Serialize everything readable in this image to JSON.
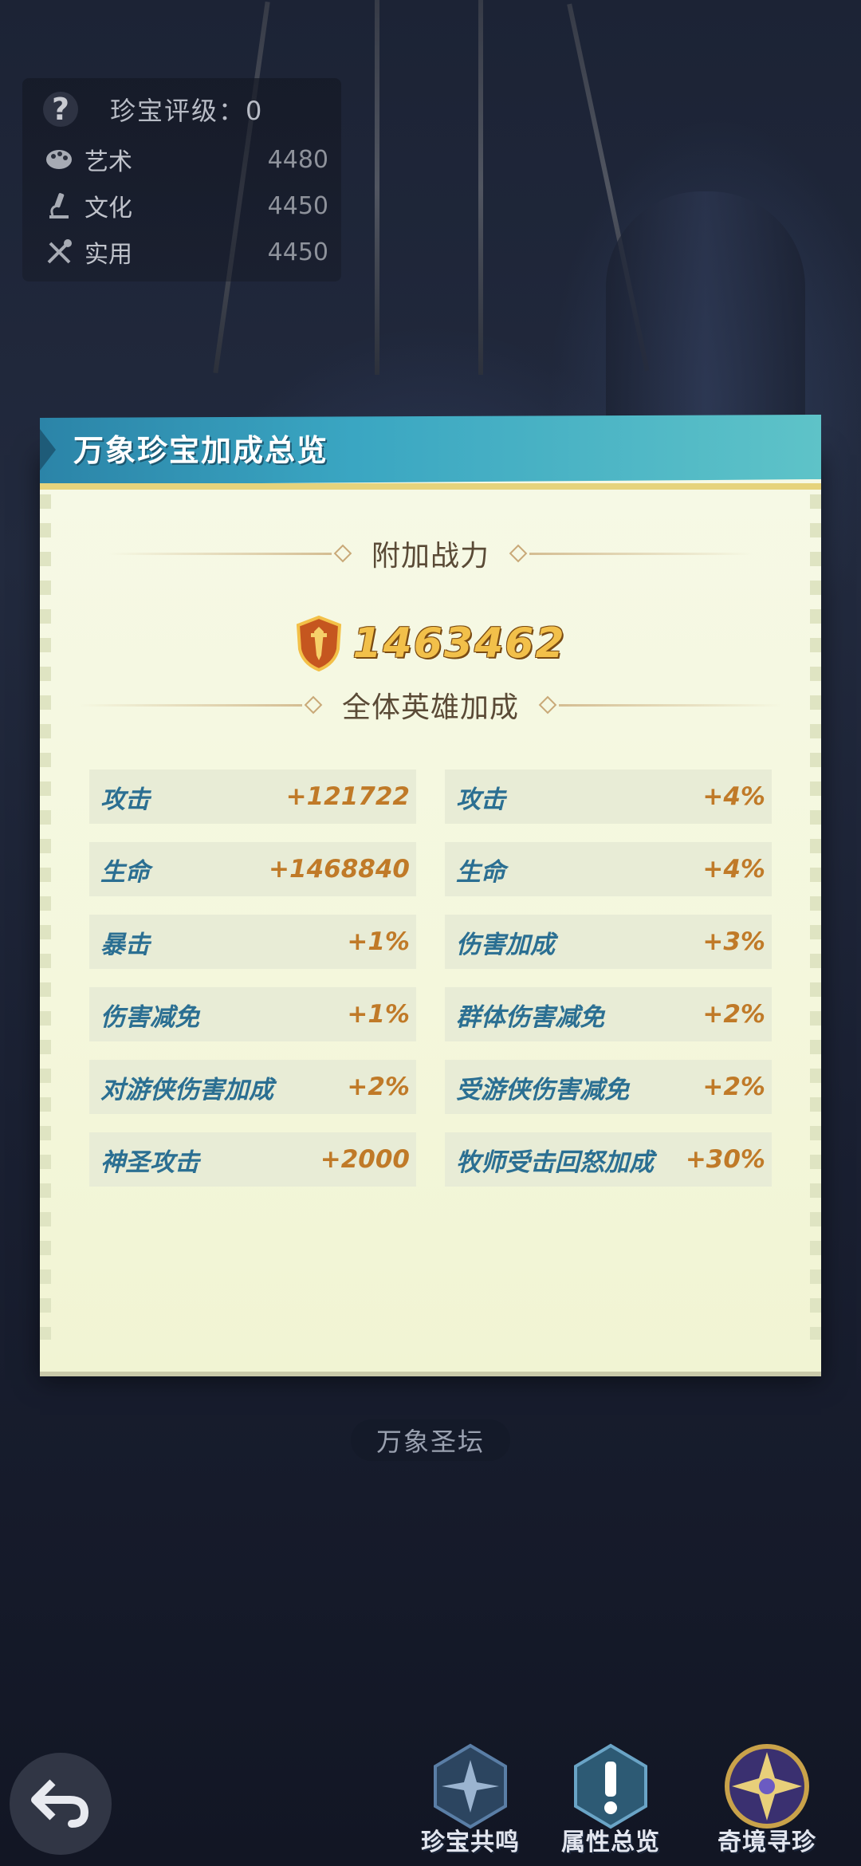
{
  "info": {
    "rating_label": "珍宝评级：0",
    "rows": [
      {
        "label": "艺术",
        "value": "4480",
        "icon": "palette-icon"
      },
      {
        "label": "文化",
        "value": "4450",
        "icon": "microscope-icon"
      },
      {
        "label": "实用",
        "value": "4450",
        "icon": "tools-icon"
      }
    ]
  },
  "modal": {
    "title": "万象珍宝加成总览",
    "power_section": "附加战力",
    "power_value": "1463462",
    "bonus_section": "全体英雄加成",
    "stats": [
      {
        "name": "攻击",
        "value": "+121722"
      },
      {
        "name": "攻击",
        "value": "+4%"
      },
      {
        "name": "生命",
        "value": "+1468840"
      },
      {
        "name": "生命",
        "value": "+4%"
      },
      {
        "name": "暴击",
        "value": "+1%"
      },
      {
        "name": "伤害加成",
        "value": "+3%"
      },
      {
        "name": "伤害减免",
        "value": "+1%"
      },
      {
        "name": "群体伤害减免",
        "value": "+2%"
      },
      {
        "name": "对游侠伤害加成",
        "value": "+2%"
      },
      {
        "name": "受游侠伤害减免",
        "value": "+2%"
      },
      {
        "name": "神圣攻击",
        "value": "+2000"
      },
      {
        "name": "牧师受击回怒加成",
        "value": "+30%"
      }
    ]
  },
  "altar_label": "万象圣坛",
  "nav": {
    "items": [
      {
        "label": "珍宝共鸣",
        "icon": "star-emblem-icon"
      },
      {
        "label": "属性总览",
        "icon": "exclamation-icon"
      },
      {
        "label": "奇境寻珍",
        "icon": "compass-star-icon"
      }
    ]
  },
  "colors": {
    "accent": "#3aa6c2",
    "stat_name": "#2b6f92",
    "stat_value": "#c07a28"
  }
}
